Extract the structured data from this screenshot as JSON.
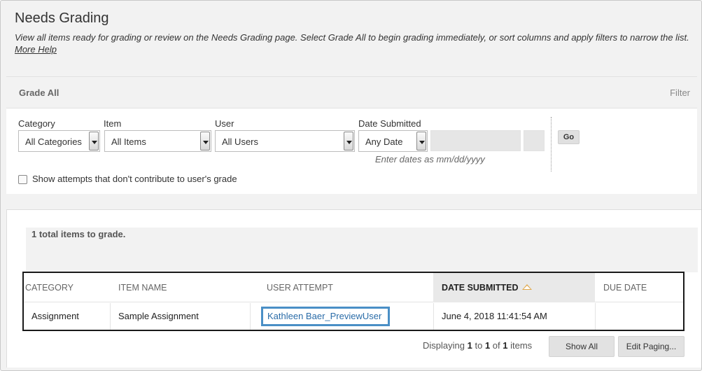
{
  "page": {
    "title": "Needs Grading",
    "description": "View all items ready for grading or review on the Needs Grading page. Select Grade All to begin grading immediately, or sort columns and apply filters to narrow the list.",
    "more_help": "More Help"
  },
  "toolbar": {
    "grade_all": "Grade All",
    "filter": "Filter"
  },
  "filters": {
    "category": {
      "label": "Category",
      "value": "All Categories"
    },
    "item": {
      "label": "Item",
      "value": "All Items"
    },
    "user": {
      "label": "User",
      "value": "All Users"
    },
    "date": {
      "label": "Date Submitted",
      "value": "Any Date",
      "hint": "Enter dates as mm/dd/yyyy"
    },
    "go": "Go",
    "checkbox_label": "Show attempts that don't contribute to user's grade",
    "checkbox_checked": false
  },
  "results": {
    "total": "1 total items to grade.",
    "columns": [
      "CATEGORY",
      "ITEM NAME",
      "USER ATTEMPT",
      "DATE SUBMITTED",
      "DUE DATE"
    ],
    "sorted_column": "DATE SUBMITTED",
    "rows": [
      {
        "category": "Assignment",
        "item_name": "Sample Assignment",
        "user_attempt": "Kathleen Baer_PreviewUser",
        "date_submitted": "June 4, 2018 11:41:54 AM",
        "due_date": ""
      }
    ],
    "paging": {
      "prefix": "Displaying",
      "from": "1",
      "to_word": "to",
      "to": "1",
      "of_word": "of",
      "total": "1",
      "suffix": "items"
    },
    "show_all": "Show All",
    "edit_paging": "Edit Paging..."
  },
  "colors": {
    "link": "#2a6ca8",
    "highlight_border": "#4a8fc6",
    "sort_icon": "#e0a84a"
  },
  "icons": {
    "sort": "sort-ascending-icon",
    "dropdown": "dropdown-arrow-icon"
  }
}
